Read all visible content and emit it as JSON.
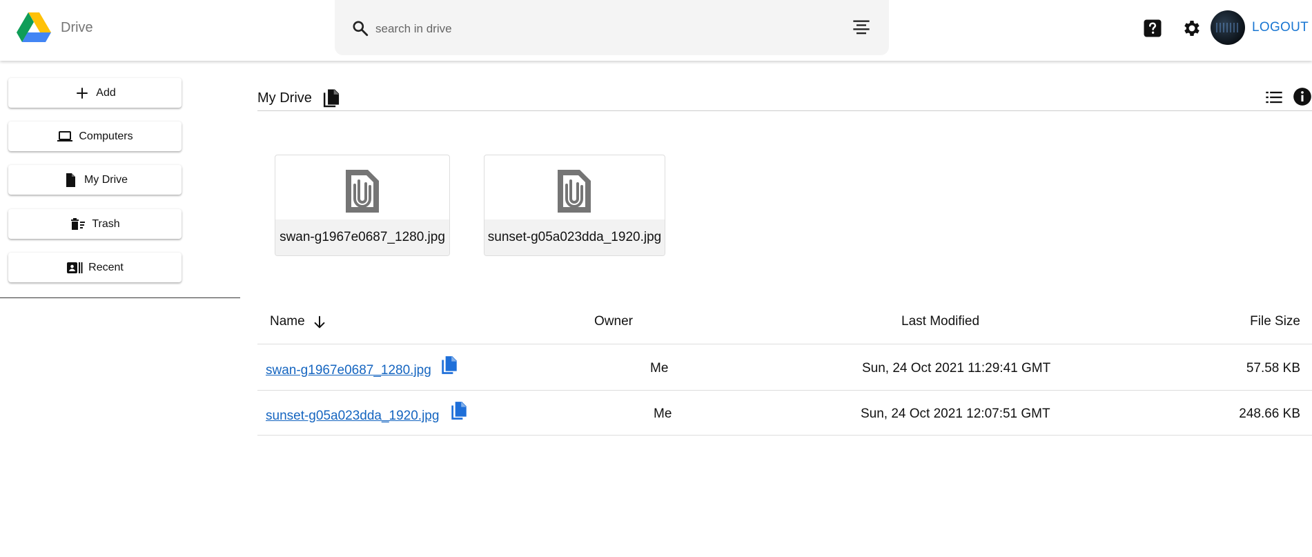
{
  "header": {
    "app_title": "Drive",
    "search_placeholder": "search in drive",
    "logout_label": "LOGOUT"
  },
  "sidebar": {
    "items": [
      {
        "label": "Add",
        "icon": "plus-icon"
      },
      {
        "label": "Computers",
        "icon": "laptop-icon"
      },
      {
        "label": "My Drive",
        "icon": "file-icon"
      },
      {
        "label": "Trash",
        "icon": "trash-icon"
      },
      {
        "label": "Recent",
        "icon": "recent-icon"
      }
    ]
  },
  "main": {
    "breadcrumb": "My Drive",
    "cards": [
      {
        "name": "swan-g1967e0687_1280.jpg",
        "icon": "attachment-icon"
      },
      {
        "name": "sunset-g05a023dda_1920.jpg",
        "icon": "attachment-icon"
      }
    ],
    "table": {
      "headers": {
        "name": "Name",
        "owner": "Owner",
        "modified": "Last Modified",
        "size": "File Size"
      },
      "rows": [
        {
          "name": "swan-g1967e0687_1280.jpg",
          "owner": "Me",
          "modified": "Sun, 24 Oct 2021 11:29:41 GMT",
          "size": "57.58 KB"
        },
        {
          "name": "sunset-g05a023dda_1920.jpg",
          "owner": "Me",
          "modified": "Sun, 24 Oct 2021 12:07:51 GMT",
          "size": "248.66 KB"
        }
      ]
    }
  },
  "colors": {
    "accent": "#1976d2",
    "link": "#1565c0",
    "copy_icon": "#1e6fd9"
  }
}
